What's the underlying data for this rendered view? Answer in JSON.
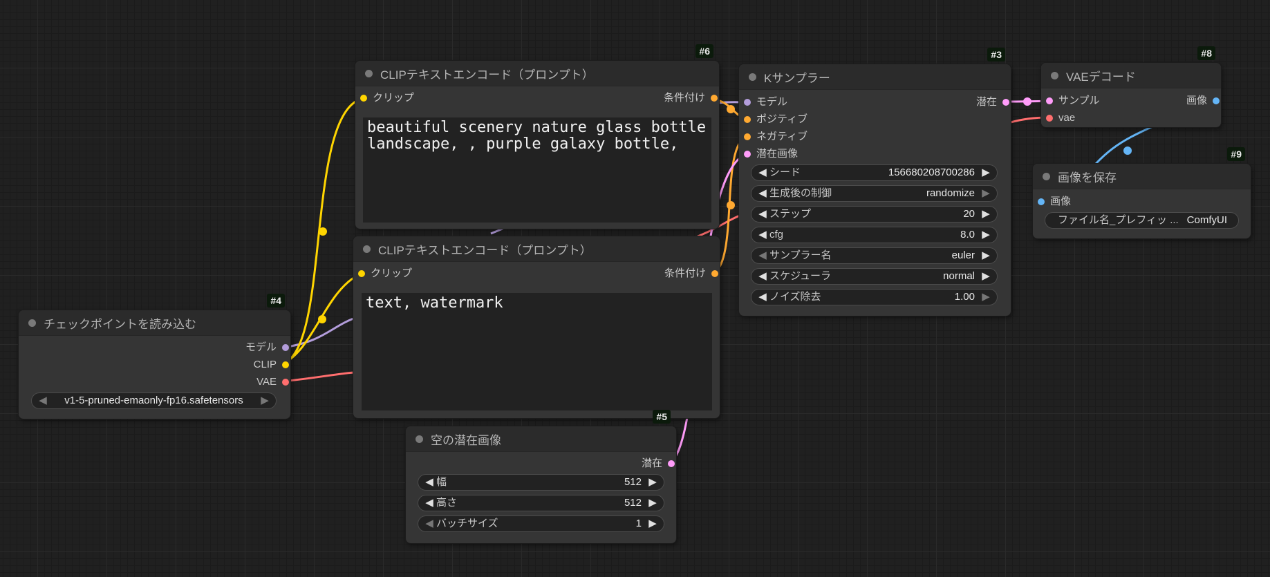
{
  "colors": {
    "model": "#b39ddb",
    "clip": "#ffd500",
    "vae": "#ff6e6e",
    "conditioning": "#ffa931",
    "latent": "#ff9cf9",
    "image": "#64b5f6"
  },
  "nodes": {
    "checkpoint": {
      "id": "#4",
      "title": "チェックポイントを読み込む",
      "outputs": {
        "model": "モデル",
        "clip": "CLIP",
        "vae": "VAE"
      },
      "ckpt_name": "v1-5-pruned-emaonly-fp16.safetensors"
    },
    "clip_pos": {
      "id": "#6",
      "title": "CLIPテキストエンコード（プロンプト）",
      "input_clip": "クリップ",
      "output_cond": "条件付け",
      "text": "beautiful scenery nature glass bottle\nlandscape, , purple galaxy bottle,"
    },
    "clip_neg": {
      "title": "CLIPテキストエンコード（プロンプト）",
      "input_clip": "クリップ",
      "output_cond": "条件付け",
      "text": "text, watermark"
    },
    "empty_latent": {
      "id": "#5",
      "title": "空の潜在画像",
      "output_latent": "潜在",
      "widgets": [
        {
          "label": "幅",
          "value": "512"
        },
        {
          "label": "高さ",
          "value": "512"
        },
        {
          "label": "バッチサイズ",
          "value": "1"
        }
      ]
    },
    "ksampler": {
      "id": "#3",
      "title": "Kサンプラー",
      "inputs": {
        "model": "モデル",
        "positive": "ポジティブ",
        "negative": "ネガティブ",
        "latent": "潜在画像"
      },
      "output_latent": "潜在",
      "widgets": [
        {
          "label": "シード",
          "value": "156680208700286"
        },
        {
          "label": "生成後の制御",
          "value": "randomize"
        },
        {
          "label": "ステップ",
          "value": "20"
        },
        {
          "label": "cfg",
          "value": "8.0"
        },
        {
          "label": "サンプラー名",
          "value": "euler"
        },
        {
          "label": "スケジューラ",
          "value": "normal"
        },
        {
          "label": "ノイズ除去",
          "value": "1.00"
        }
      ]
    },
    "vae_decode": {
      "id": "#8",
      "title": "VAEデコード",
      "inputs": {
        "samples": "サンプル",
        "vae": "vae"
      },
      "output_image": "画像"
    },
    "save_image": {
      "id": "#9",
      "title": "画像を保存",
      "input_images": "画像",
      "filename_label": "ファイル名_プレフィッ ...",
      "filename_value": "ComfyUI"
    }
  }
}
